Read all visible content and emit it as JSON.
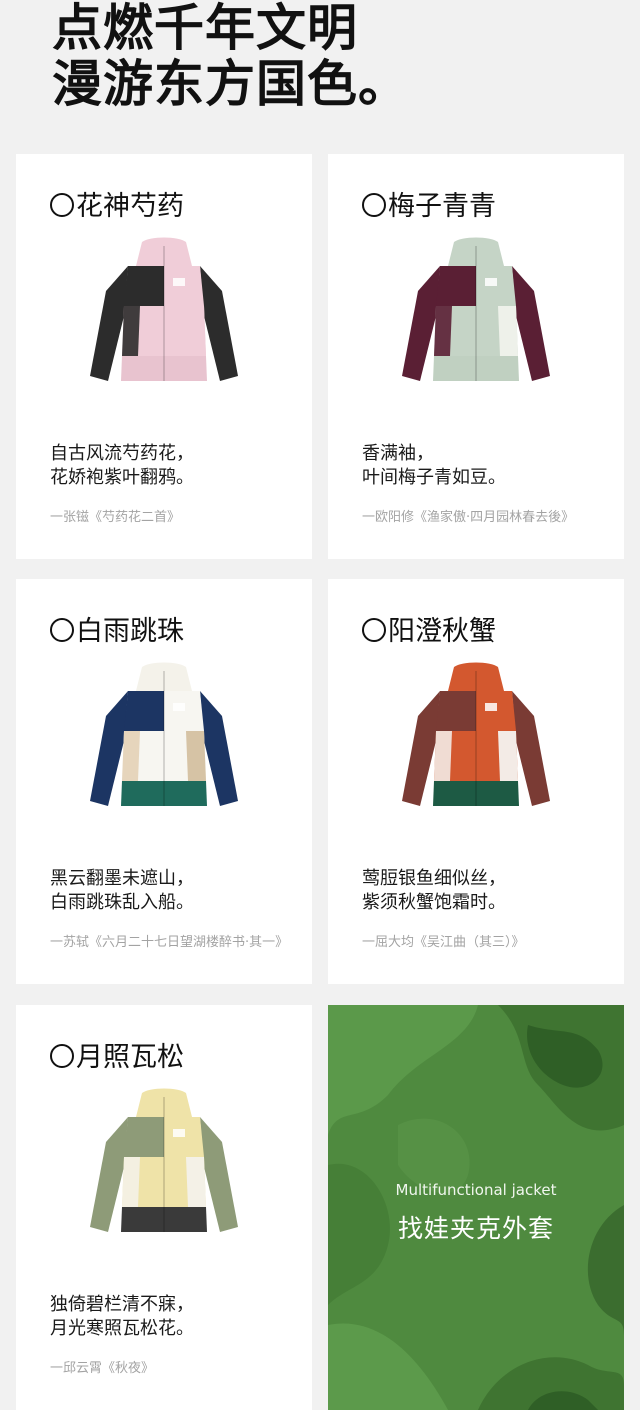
{
  "hero": {
    "line1": "点燃千年文明",
    "line2": "漫游东方国色。"
  },
  "cards": [
    {
      "title": "花神芍药",
      "poem_line1": "自古风流芍药花，",
      "poem_line2": "花娇袍紫叶翻鸦。",
      "source": "一张镃《芍药花二首》",
      "colors": {
        "upper": "#f0cdd8",
        "lower": "#e8c3cf",
        "sleeve": "#2c2c2c",
        "hood": "#f0cdd8",
        "left_block": "#2c2c2c",
        "right_block": "#f0cdd8",
        "accent": "#2c2c2c"
      }
    },
    {
      "title": "梅子青青",
      "poem_line1": "香满袖，",
      "poem_line2": "叶间梅子青如豆。",
      "source": "一欧阳修《渔家傲·四月园林春去後》",
      "colors": {
        "upper": "#c5d4c6",
        "lower": "#c0d0c1",
        "sleeve": "#5a1f34",
        "hood": "#c5d4c6",
        "left_block": "#5a1f34",
        "right_block": "#eef1ea",
        "accent": "#5a1f34"
      }
    },
    {
      "title": "白雨跳珠",
      "poem_line1": "黑云翻墨未遮山，",
      "poem_line2": "白雨跳珠乱入船。",
      "source": "一苏轼《六月二十七日望湖楼醉书·其一》",
      "colors": {
        "upper": "#f7f6f1",
        "lower": "#1f6b5c",
        "sleeve": "#1c3563",
        "hood": "#f4f2ea",
        "left_block": "#1c3563",
        "right_block": "#d6c3a5",
        "accent": "#e3d2b6"
      }
    },
    {
      "title": "阳澄秋蟹",
      "poem_line1": "莺脰银鱼细似丝，",
      "poem_line2": "紫须秋蟹饱霜时。",
      "source": "一屈大均《吴江曲（其三）》",
      "colors": {
        "upper": "#d3582f",
        "lower": "#1d5a44",
        "sleeve": "#7a3b34",
        "hood": "#d3582f",
        "left_block": "#7a3b34",
        "right_block": "#f3ebe6",
        "accent": "#f3ebe6"
      }
    },
    {
      "title": "月照瓦松",
      "poem_line1": "独倚碧栏清不寐，",
      "poem_line2": "月光寒照瓦松花。",
      "source": "一邱云霄《秋夜》",
      "colors": {
        "upper": "#efe3a8",
        "lower": "#3a3a3a",
        "sleeve": "#8e9b78",
        "hood": "#efe3a8",
        "left_block": "#8e9b78",
        "right_block": "#f4f1e7",
        "accent": "#f4f1e7"
      }
    }
  ],
  "promo": {
    "subtitle": "Multifunctional jacket",
    "title": "找娃夹克外套",
    "bg": "#4f8a3f"
  }
}
